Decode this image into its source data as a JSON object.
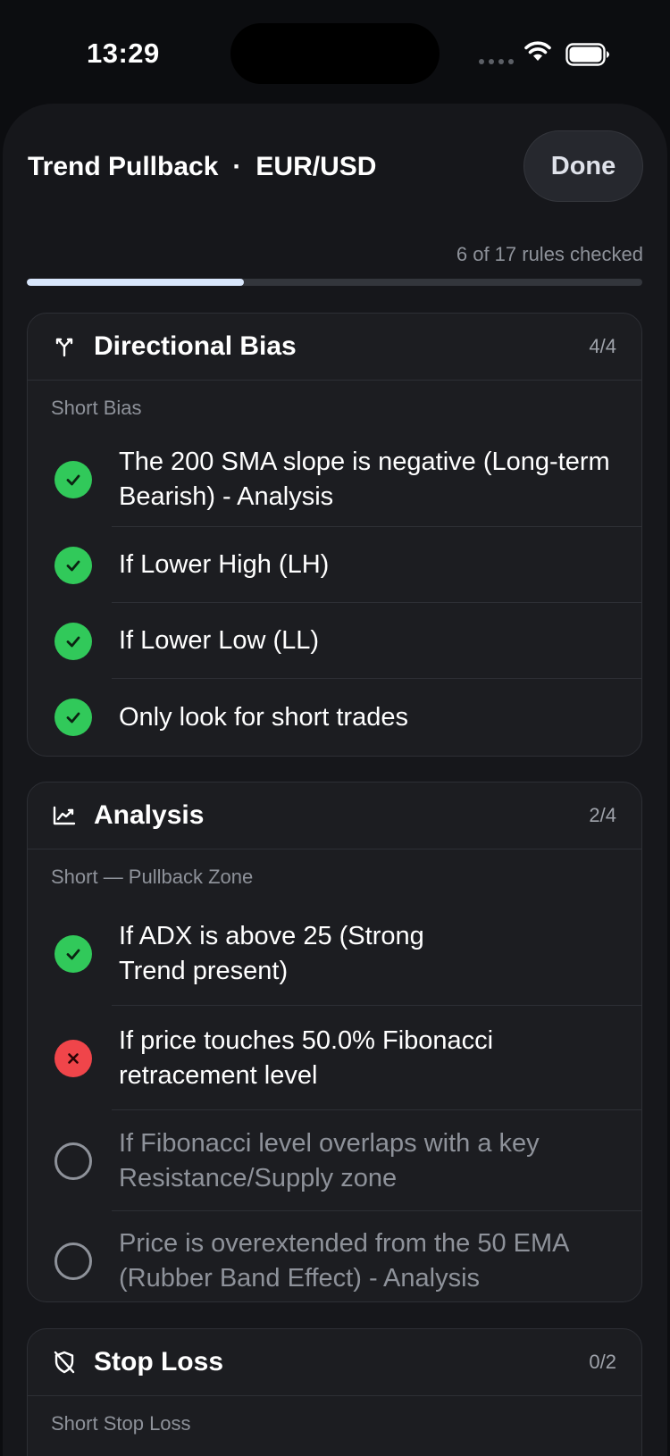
{
  "status_bar": {
    "time": "13:29"
  },
  "header": {
    "strategy": "Trend Pullback",
    "separator": "·",
    "pair": "EUR/USD",
    "done_label": "Done"
  },
  "progress": {
    "text": "6 of 17 rules checked",
    "checked": 6,
    "total": 17
  },
  "colors": {
    "accent": "#d8e6fb",
    "pass": "#31c95a",
    "fail": "#f0454a",
    "background": "#16171b",
    "card": "#1c1d21"
  },
  "sections": [
    {
      "title": "Directional Bias",
      "icon": "split-arrows-icon",
      "count": "4/4",
      "group": "Short Bias",
      "rules": [
        {
          "text": "The 200 SMA slope is negative (Long-term Bearish) - Analysis",
          "status": "checked"
        },
        {
          "text": "If Lower High (LH)",
          "status": "checked"
        },
        {
          "text": "If Lower Low (LL)",
          "status": "checked"
        },
        {
          "text": "Only look for short trades",
          "status": "checked"
        }
      ]
    },
    {
      "title": "Analysis",
      "icon": "line-chart-icon",
      "count": "2/4",
      "group": "Short — Pullback Zone",
      "rules": [
        {
          "text": "If ADX is above 25 (Strong Trend present)",
          "status": "checked"
        },
        {
          "text": "If price touches 50.0% Fibonacci retracement level",
          "status": "failed"
        },
        {
          "text": "If Fibonacci level overlaps with a key Resistance/Supply zone",
          "status": "unchecked"
        },
        {
          "text": "Price is overextended from the 50 EMA (Rubber Band Effect) - Analysis",
          "status": "unchecked"
        }
      ]
    },
    {
      "title": "Stop Loss",
      "icon": "shield-off-icon",
      "count": "0/2",
      "group": "Short Stop Loss",
      "rules": []
    }
  ]
}
